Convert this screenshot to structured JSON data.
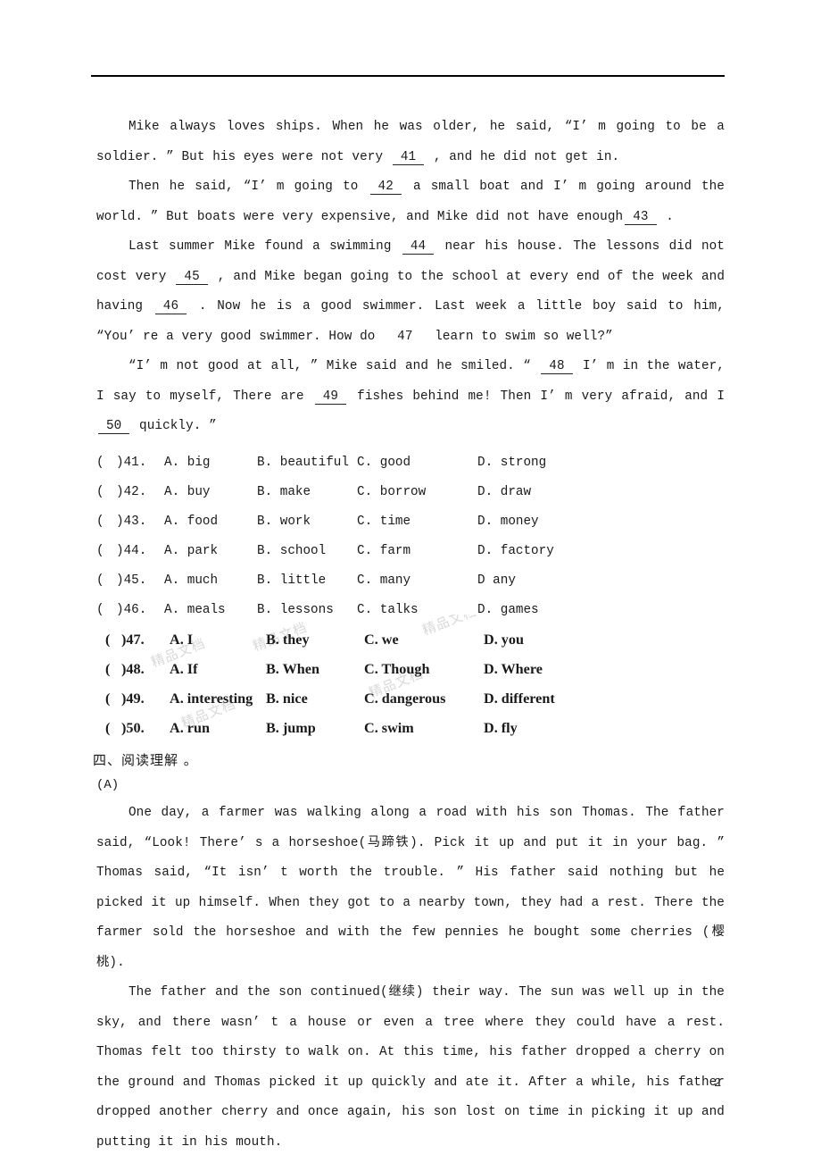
{
  "document": {
    "page_number": "2",
    "header_rule": true
  },
  "cloze": {
    "paragraphs": [
      {
        "id": "p1",
        "segments": [
          {
            "type": "text",
            "value": "Mike always loves ships. When he was older,  he said,  “I’ m going to be a soldier. ” But his eyes were not very "
          },
          {
            "type": "blank",
            "value": "41"
          },
          {
            "type": "text",
            "value": " ,  and he did not get in."
          }
        ]
      },
      {
        "id": "p2",
        "segments": [
          {
            "type": "text",
            "value": "Then he said,  “I’ m going to "
          },
          {
            "type": "blank",
            "value": "42"
          },
          {
            "type": "text",
            "value": " a small boat and I’ m going around the world. ” But boats were very expensive,  and Mike did not have enough"
          },
          {
            "type": "blank",
            "value": "43"
          },
          {
            "type": "text",
            "value": " ."
          }
        ]
      },
      {
        "id": "p3",
        "segments": [
          {
            "type": "text",
            "value": "Last summer Mike found a swimming "
          },
          {
            "type": "blank",
            "value": "44"
          },
          {
            "type": "text",
            "value": " near his house. The lessons did not cost very "
          },
          {
            "type": "blank",
            "value": "45"
          },
          {
            "type": "text",
            "value": " ,  and Mike began going to the school at every end of the week and having "
          },
          {
            "type": "blank",
            "value": "46"
          },
          {
            "type": "text",
            "value": " . Now he is a good swimmer. Last week a little boy said to him,  “You’ re a very good swimmer. How do "
          },
          {
            "type": "blank_noline",
            "value": "47"
          },
          {
            "type": "text",
            "value": " learn to swim so well?”"
          }
        ]
      },
      {
        "id": "p4",
        "segments": [
          {
            "type": "text",
            "value": "“I’ m not good at all,  ” Mike said and he smiled. “ "
          },
          {
            "type": "blank",
            "value": "48"
          },
          {
            "type": "text",
            "value": " I’ m in the water,  I say to myself,  There are "
          },
          {
            "type": "blank",
            "value": "49"
          },
          {
            "type": "text",
            "value": " fishes behind me! Then I’ m very afraid,  and I "
          },
          {
            "type": "blank",
            "value": "50"
          },
          {
            "type": "text",
            "value": " quickly. ”"
          }
        ]
      }
    ],
    "questions": [
      {
        "paren": "(",
        "num": ")41.",
        "a": "A. big",
        "b": "B. beautiful",
        "c": "C. good",
        "d": "D. strong",
        "bold": false
      },
      {
        "paren": "(",
        "num": ")42.",
        "a": "A. buy",
        "b": "B. make",
        "c": "C. borrow",
        "d": "D. draw",
        "bold": false
      },
      {
        "paren": "(",
        "num": ")43.",
        "a": "A. food",
        "b": "B. work",
        "c": "C. time",
        "d": "D. money",
        "bold": false
      },
      {
        "paren": "(",
        "num": ")44.",
        "a": "A. park",
        "b": "B. school",
        "c": "C. farm",
        "d": "D. factory",
        "bold": false
      },
      {
        "paren": "(",
        "num": ")45.",
        "a": "A. much",
        "b": "B. little",
        "c": "C. many",
        "d": "D any",
        "bold": false
      },
      {
        "paren": "(",
        "num": ")46.",
        "a": "A. meals",
        "b": "B. lessons",
        "c": "C. talks",
        "d": "D. games",
        "bold": false
      },
      {
        "paren": "(",
        "num": ")47.",
        "a": "A. I",
        "b": "B. they",
        "c": "C. we",
        "d": "D. you",
        "bold": true
      },
      {
        "paren": "(",
        "num": ")48.",
        "a": "A. If",
        "b": "B. When",
        "c": "C. Though",
        "d": "D. Where",
        "bold": true
      },
      {
        "paren": "(",
        "num": ")49.",
        "a": "A. interesting",
        "b": "B. nice",
        "c": "C. dangerous",
        "d": "D. different",
        "bold": true
      },
      {
        "paren": "(",
        "num": ")50.",
        "a": "A. run",
        "b": "B. jump",
        "c": "C. swim",
        "d": "D. fly",
        "bold": true
      }
    ],
    "watermark_text": "精品文档"
  },
  "reading_section": {
    "heading": "四、阅读理解 。",
    "sub_label": "(A)",
    "passages": [
      {
        "id": "r1",
        "text": "One day, a farmer was walking along a road with his son Thomas. The father said, “Look! There’ s a horseshoe(马蹄铁). Pick it up and put it in your bag. ” Thomas said, “It isn’ t worth the trouble. ” His father said nothing but he picked it up himself. When they got to a nearby town, they had a rest. There the farmer sold the horseshoe and with the few pennies he bought some cherries (樱桃)."
      },
      {
        "id": "r2",
        "text": "The father and the son continued(继续) their way. The sun was well up in the sky, and there wasn’ t a house or even a tree where they could have a rest. Thomas felt too thirsty to walk on. At this time, his father dropped a cherry on the ground and Thomas picked it up quickly and ate it. After a while, his father dropped another cherry and once again, his son lost on time in picking it up and putting it in his mouth."
      }
    ]
  }
}
